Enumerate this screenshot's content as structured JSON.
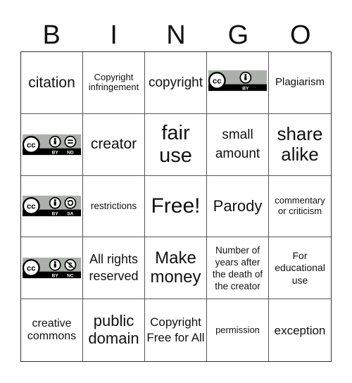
{
  "title_letters": [
    "B",
    "I",
    "N",
    "G",
    "O"
  ],
  "colors": {
    "badge_gray": "#abb1aa",
    "badge_black": "#000000",
    "border": "#555555"
  },
  "cells": [
    {
      "text": "citation",
      "type": "text"
    },
    {
      "text": "Copyright infringement",
      "type": "text"
    },
    {
      "text": "copyright",
      "type": "text"
    },
    {
      "type": "badge",
      "badge": "cc-by",
      "badge_labels": [
        "BY"
      ],
      "icon": "creative-commons-by-icon"
    },
    {
      "text": "Plagiarism",
      "type": "text"
    },
    {
      "type": "badge",
      "badge": "cc-by-nd",
      "badge_labels": [
        "BY",
        "ND"
      ],
      "icon": "creative-commons-by-nd-icon"
    },
    {
      "text": "creator",
      "type": "text"
    },
    {
      "text": "fair use",
      "type": "text"
    },
    {
      "text": "small amount",
      "type": "text"
    },
    {
      "text": "share alike",
      "type": "text"
    },
    {
      "type": "badge",
      "badge": "cc-by-sa",
      "badge_labels": [
        "BY",
        "SA"
      ],
      "icon": "creative-commons-by-sa-icon"
    },
    {
      "text": "restrictions",
      "type": "text"
    },
    {
      "text": "Free!",
      "type": "text"
    },
    {
      "text": "Parody",
      "type": "text"
    },
    {
      "text": "commentary or criticism",
      "type": "text"
    },
    {
      "type": "badge",
      "badge": "cc-by-nc",
      "badge_labels": [
        "BY",
        "NC"
      ],
      "icon": "creative-commons-by-nc-icon"
    },
    {
      "text": "All rights reserved",
      "type": "text"
    },
    {
      "text": "Make money",
      "type": "text"
    },
    {
      "text": "Number of years after the death of the creator",
      "type": "text"
    },
    {
      "text": "For educational use",
      "type": "text"
    },
    {
      "text": "creative commons",
      "type": "text"
    },
    {
      "text": "public domain",
      "type": "text"
    },
    {
      "text": "Copyright Free for All",
      "type": "text"
    },
    {
      "text": "permission",
      "type": "text"
    },
    {
      "text": "exception",
      "type": "text"
    }
  ]
}
